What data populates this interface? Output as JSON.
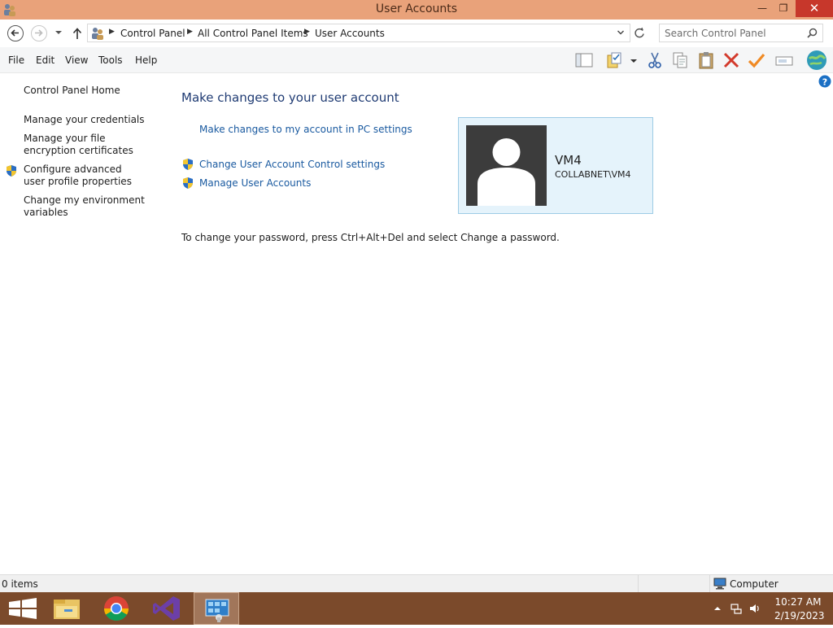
{
  "window": {
    "title": "User Accounts",
    "minimize_glyph": "—",
    "maximize_glyph": "❐",
    "close_glyph": "✕"
  },
  "address": {
    "crumbs": [
      "Control Panel",
      "All Control Panel Items",
      "User Accounts"
    ],
    "search_placeholder": "Search Control Panel"
  },
  "menu": [
    "File",
    "Edit",
    "View",
    "Tools",
    "Help"
  ],
  "toolbar_icons": [
    "layout-icon",
    "properties-icon",
    "cut-icon",
    "copy-icon",
    "paste-icon",
    "delete-icon",
    "check-icon",
    "rename-icon",
    "globe-icon"
  ],
  "left_nav": {
    "home": "Control Panel Home",
    "items": [
      "Manage your credentials",
      "Manage your file encryption certificates",
      "Configure advanced user profile properties",
      "Change my environment variables"
    ]
  },
  "main": {
    "title": "Make changes to your user account",
    "pc_settings_link": "Make changes to my account in PC settings",
    "uac_link": "Change User Account Control settings",
    "manage_link": "Manage User Accounts",
    "password_note": "To change your password, press Ctrl+Alt+Del and select Change a password."
  },
  "user": {
    "name": "VM4",
    "domain": "COLLABNET\\VM4"
  },
  "status": {
    "count": "0 items",
    "location": "Computer"
  },
  "taskbar": {
    "apps": [
      "windows-start-icon",
      "file-explorer-icon",
      "chrome-icon",
      "visual-studio-icon",
      "control-panel-icon"
    ],
    "time": "10:27 AM",
    "date": "2/19/2023"
  },
  "colors": {
    "titlebar": "#e9a27a",
    "link": "#1a5aa0",
    "taskbar": "#7b4a2b",
    "tile_bg": "#e5f3fb"
  }
}
